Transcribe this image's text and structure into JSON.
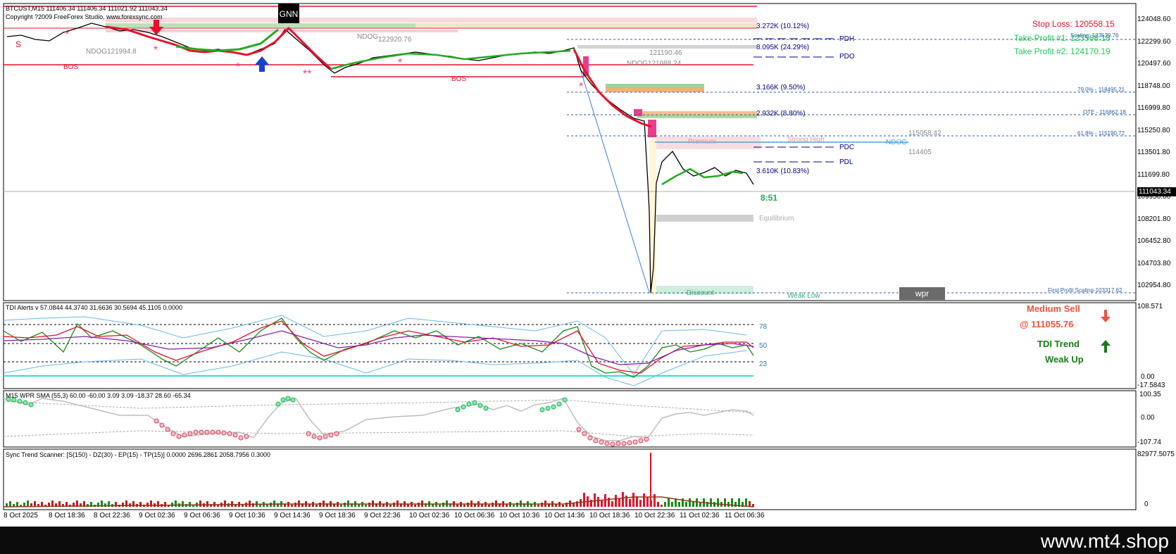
{
  "header": {
    "symbol_line": "BTCUST,M15  111406.34 111406.34 111021.92 111043.34",
    "copyright": "Copyright ?2009 FreeForex Studio, www.forexsync.com",
    "gnn_label": "GNN"
  },
  "trade_info": {
    "stop_loss": "Stop Loss: 120558.15",
    "take_profit_1": "Take Profit #1: 123568.18",
    "take_profit_2": "Take Profit #2: 124170.19",
    "colors": {
      "stop_loss": "#e8102a",
      "take_profit": "#22c55e"
    }
  },
  "main_chart": {
    "current_price": "111043.34",
    "price_axis": [
      "124048.60",
      "122299.60",
      "120497.60",
      "118748.00",
      "116999.80",
      "115250.80",
      "113501.80",
      "111699.80",
      "109950.80",
      "108201.80",
      "106452.80",
      "104703.80",
      "102954.80"
    ],
    "levels": {
      "pdh": "PDH",
      "pdo": "PDO",
      "pdc": "PDC",
      "pdl": "PDL",
      "ndog_right": "NDOG",
      "val_115058": "115058.42",
      "val_114405": "114405",
      "k1": "8.095K (24.29%)",
      "k2": "3.166K (9.50%)",
      "k3": "2.932K (8.80%)",
      "k4": "3.610K (10.83%)",
      "k5": "3.272K (10.12%)",
      "fib_79": "79.0% - 118495.21",
      "ote": "OTE - 116862.18",
      "fib_618": "61.8% - 115190.72",
      "first_profit": "First Profit Scaling-103317.62",
      "premium": "Premium",
      "strong_high": "Strong High",
      "equilibrium": "Equilibrium",
      "discount": "Discount",
      "weak_low": "Weak Low",
      "countdown": "8:51",
      "ndog_121994": "NDOG121994.8",
      "ndog_122920": "122920.76",
      "ndog_label": "NDOG",
      "val_121190": "121190.46",
      "ndog_121068": "NDOG121088.24",
      "bos1": "BOS",
      "bos2": "BOS",
      "s_label": "S",
      "scaling_right": "Scaling: 123539.76"
    },
    "wpr_button": "wpr"
  },
  "tdi_panel": {
    "header": "TDI Alerts v 57.0844 44.3740 31.6636 30.5694 45.1105 0.0000",
    "levels": [
      "78",
      "50",
      "23"
    ],
    "axis": [
      "108.571",
      "0.00",
      "-17.5843"
    ],
    "signal": "Medium Sell",
    "signal_price": "@ 111055.76",
    "trend_title": "TDI Trend",
    "trend_value": "Weak Up"
  },
  "wpr_panel": {
    "header": "M15 WPR  SMA (55,3) 60.00 -60.00 3.09 3.09 -18.37 28.60 -65.34",
    "axis": [
      "100.35",
      "0.00",
      "-107.74"
    ]
  },
  "scanner_panel": {
    "header": "Sync Trend Scanner: [S(150) - DZ(30) - EP(15) - TP(15)] 0.0000 2696.2861 2058.7956 0.3000",
    "axis": [
      "82977.5075",
      "0"
    ]
  },
  "time_axis": [
    "8 Oct 2025",
    "8 Oct 18:36",
    "8 Oct 22:36",
    "9 Oct 02:36",
    "9 Oct 06:36",
    "9 Oct 10:36",
    "9 Oct 14:36",
    "9 Oct 18:36",
    "9 Oct 22:36",
    "10 Oct 02:36",
    "10 Oct 06:36",
    "10 Oct 10:36",
    "10 Oct 14:36",
    "10 Oct 18:36",
    "10 Oct 22:36",
    "11 Oct 02:36",
    "11 Oct 06:36"
  ],
  "footer": {
    "brand": "www.mt4.shop"
  }
}
